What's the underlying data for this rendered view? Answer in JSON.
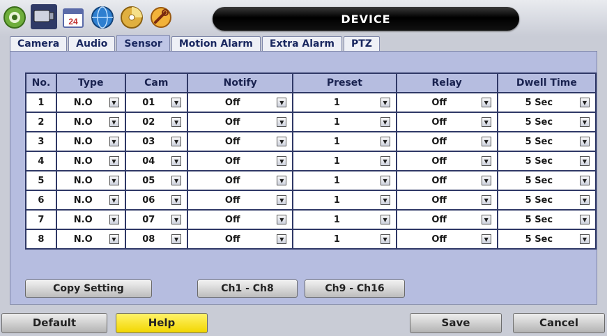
{
  "window": {
    "title": "DEVICE"
  },
  "toolbar_icons": [
    "camera-icon",
    "monitor-icon",
    "calendar-icon",
    "globe-icon",
    "disc-icon",
    "tools-icon"
  ],
  "calendar_day": "24",
  "tabs": [
    {
      "label": "Camera",
      "active": false
    },
    {
      "label": "Audio",
      "active": false
    },
    {
      "label": "Sensor",
      "active": true
    },
    {
      "label": "Motion Alarm",
      "active": false
    },
    {
      "label": "Extra Alarm",
      "active": false
    },
    {
      "label": "PTZ",
      "active": false
    }
  ],
  "table": {
    "headers": [
      "No.",
      "Type",
      "Cam",
      "Notify",
      "Preset",
      "Relay",
      "Dwell Time"
    ],
    "rows": [
      {
        "no": "1",
        "type": "N.O",
        "cam": "01",
        "notify": "Off",
        "preset": "1",
        "relay": "Off",
        "dwell": "5 Sec"
      },
      {
        "no": "2",
        "type": "N.O",
        "cam": "02",
        "notify": "Off",
        "preset": "1",
        "relay": "Off",
        "dwell": "5 Sec"
      },
      {
        "no": "3",
        "type": "N.O",
        "cam": "03",
        "notify": "Off",
        "preset": "1",
        "relay": "Off",
        "dwell": "5 Sec"
      },
      {
        "no": "4",
        "type": "N.O",
        "cam": "04",
        "notify": "Off",
        "preset": "1",
        "relay": "Off",
        "dwell": "5 Sec"
      },
      {
        "no": "5",
        "type": "N.O",
        "cam": "05",
        "notify": "Off",
        "preset": "1",
        "relay": "Off",
        "dwell": "5 Sec"
      },
      {
        "no": "6",
        "type": "N.O",
        "cam": "06",
        "notify": "Off",
        "preset": "1",
        "relay": "Off",
        "dwell": "5 Sec"
      },
      {
        "no": "7",
        "type": "N.O",
        "cam": "07",
        "notify": "Off",
        "preset": "1",
        "relay": "Off",
        "dwell": "5 Sec"
      },
      {
        "no": "8",
        "type": "N.O",
        "cam": "08",
        "notify": "Off",
        "preset": "1",
        "relay": "Off",
        "dwell": "5 Sec"
      }
    ]
  },
  "panel_buttons": {
    "copy": "Copy Setting",
    "ch1": "Ch1 - Ch8",
    "ch9": "Ch9 - Ch16"
  },
  "footer": {
    "default": "Default",
    "help": "Help",
    "save": "Save",
    "cancel": "Cancel"
  },
  "colors": {
    "panel": "#b6bde0",
    "help_button": "#f5dd10",
    "title_bar": "#000000"
  }
}
